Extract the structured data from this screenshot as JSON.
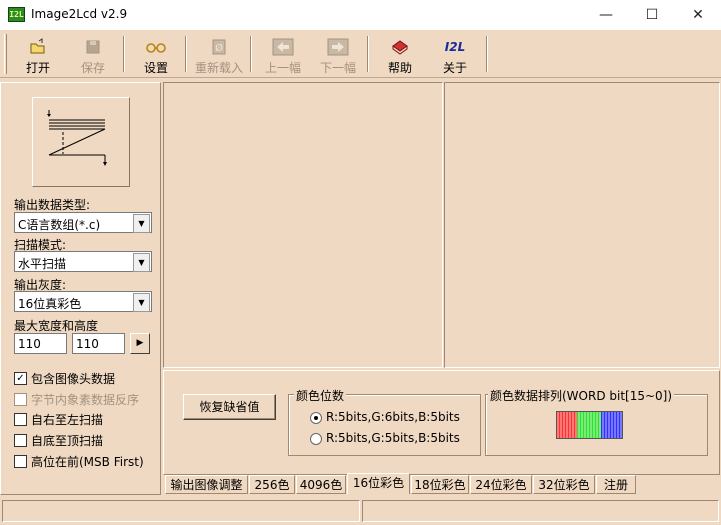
{
  "window": {
    "title": "Image2Lcd v2.9",
    "icon_text": "I2L",
    "minimize": "—",
    "maximize": "☐",
    "close": "✕"
  },
  "toolbar": {
    "open": "打开",
    "save": "保存",
    "settings": "设置",
    "reload": "重新载入",
    "prev": "上一幅",
    "next": "下一幅",
    "help": "帮助",
    "about": "关于",
    "about_icon_text": "I2L"
  },
  "left": {
    "output_type_label": "输出数据类型:",
    "output_type_value": "C语言数组(*.c)",
    "scan_mode_label": "扫描模式:",
    "scan_mode_value": "水平扫描",
    "gray_label": "输出灰度:",
    "gray_value": "16位真彩色",
    "max_size_label": "最大宽度和高度",
    "max_width": "110",
    "max_height": "110",
    "apply_arrow": "▶",
    "checkboxes": [
      {
        "label": "包含图像头数据",
        "checked": true,
        "enabled": true
      },
      {
        "label": "字节内象素数据反序",
        "checked": false,
        "enabled": false
      },
      {
        "label": "自右至左扫描",
        "checked": false,
        "enabled": true
      },
      {
        "label": "自底至顶扫描",
        "checked": false,
        "enabled": true
      },
      {
        "label": "高位在前(MSB First)",
        "checked": false,
        "enabled": true
      }
    ]
  },
  "bottom": {
    "restore_button": "恢复缺省值",
    "color_bits_title": "颜色位数",
    "radio_565": "R:5bits,G:6bits,B:5bits",
    "radio_555": "R:5bits,G:5bits,B:5bits",
    "color_order_title": "颜色数据排列(WORD bit[15~0])"
  },
  "tabs": [
    "输出图像调整",
    "256色",
    "4096色",
    "16位彩色",
    "18位彩色",
    "24位彩色",
    "32位彩色",
    "注册"
  ],
  "colors": {
    "bg": "#f0d9c2",
    "red": "#ff3030",
    "green": "#30e030",
    "blue": "#3030ff"
  }
}
